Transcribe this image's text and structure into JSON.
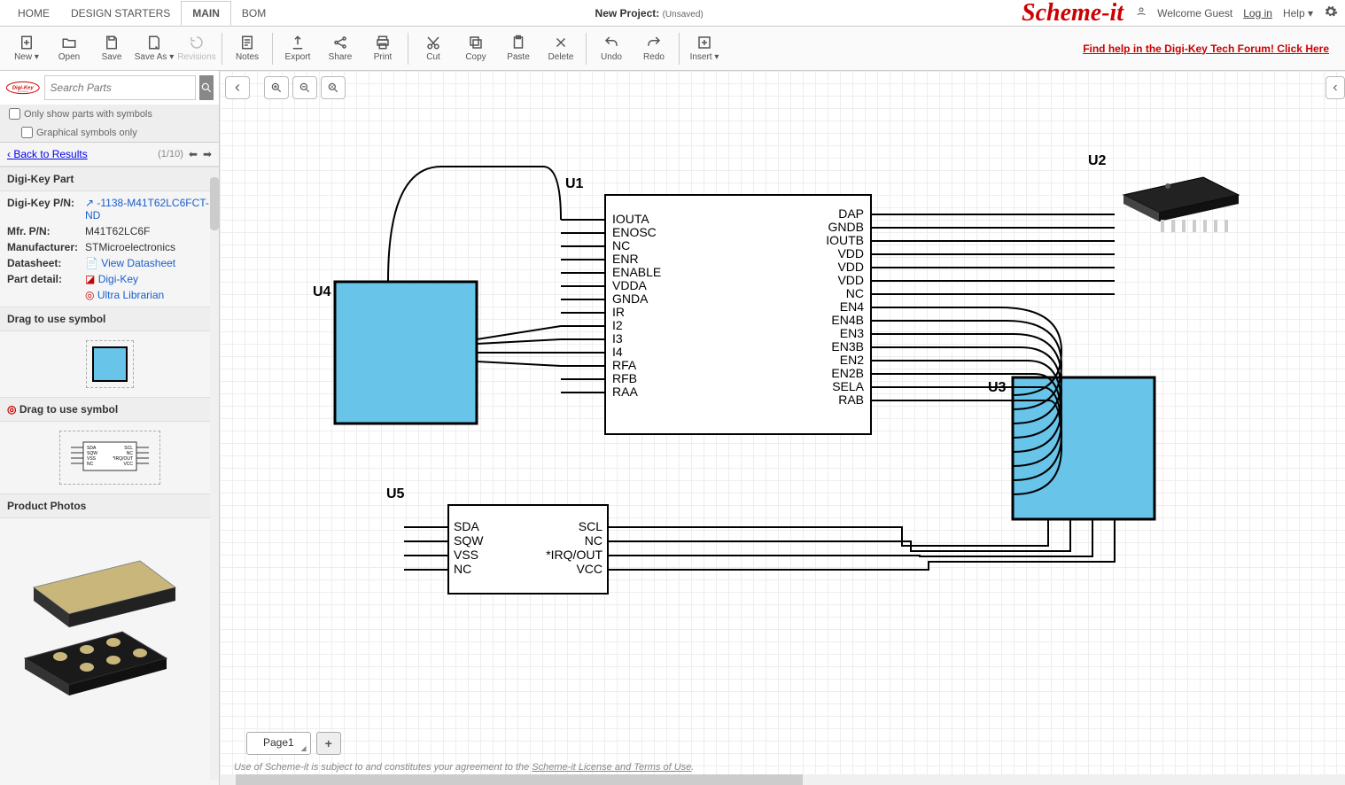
{
  "tabs": {
    "home": "HOME",
    "design": "DESIGN STARTERS",
    "main": "MAIN",
    "bom": "BOM"
  },
  "project": {
    "label": "New Project:",
    "unsaved": "(Unsaved)"
  },
  "brand": "Scheme-it",
  "user": {
    "welcome": "Welcome Guest",
    "login": "Log in",
    "help": "Help"
  },
  "toolbar": {
    "new": "New",
    "open": "Open",
    "save": "Save",
    "saveas": "Save As",
    "revisions": "Revisions",
    "notes": "Notes",
    "export": "Export",
    "share": "Share",
    "print": "Print",
    "cut": "Cut",
    "copy": "Copy",
    "paste": "Paste",
    "delete": "Delete",
    "undo": "Undo",
    "redo": "Redo",
    "insert": "Insert",
    "findhelp": "Find help in the Digi-Key Tech Forum! Click Here"
  },
  "search": {
    "placeholder": "Search Parts"
  },
  "filters": {
    "symbols_only": "Only show parts with symbols",
    "graphical_only": "Graphical symbols only"
  },
  "back": {
    "label": "Back to Results",
    "paging": "(1/10)"
  },
  "sections": {
    "dkpart": "Digi-Key Part",
    "drag1": "Drag to use symbol",
    "drag2": "Drag to use symbol",
    "photos": "Product Photos"
  },
  "part": {
    "dkpn_label": "Digi-Key P/N:",
    "dkpn_value": "-1138-M41T62LC6FCT-ND",
    "mfrpn_label": "Mfr. P/N:",
    "mfrpn_value": "M41T62LC6F",
    "mfr_label": "Manufacturer:",
    "mfr_value": "STMicroelectronics",
    "ds_label": "Datasheet:",
    "ds_value": "View Datasheet",
    "detail_label": "Part detail:",
    "detail_dk": "Digi-Key",
    "detail_ul": "Ultra Librarian"
  },
  "schematic": {
    "u1": {
      "ref": "U1",
      "left": [
        "IOUTA",
        "ENOSC",
        "NC",
        "ENR",
        "ENABLE",
        "VDDA",
        "GNDA",
        "IR",
        "I2",
        "I3",
        "I4",
        "RFA",
        "RFB",
        "RAA"
      ],
      "right": [
        "DAP",
        "GNDB",
        "IOUTB",
        "VDD",
        "VDD",
        "VDD",
        "NC",
        "EN4",
        "EN4B",
        "EN3",
        "EN3B",
        "EN2",
        "EN2B",
        "SELA",
        "RAB"
      ]
    },
    "u2": {
      "ref": "U2"
    },
    "u3": {
      "ref": "U3"
    },
    "u4": {
      "ref": "U4"
    },
    "u5": {
      "ref": "U5",
      "left": [
        "SDA",
        "SQW",
        "VSS",
        "NC"
      ],
      "right": [
        "SCL",
        "NC",
        "*IRQ/OUT",
        "VCC"
      ]
    }
  },
  "page": {
    "current": "Page1"
  },
  "footer": {
    "prefix": "Use of Scheme-it is subject to and constitutes your agreement to the ",
    "link": "Scheme-it License and Terms of Use",
    "suffix": "."
  }
}
